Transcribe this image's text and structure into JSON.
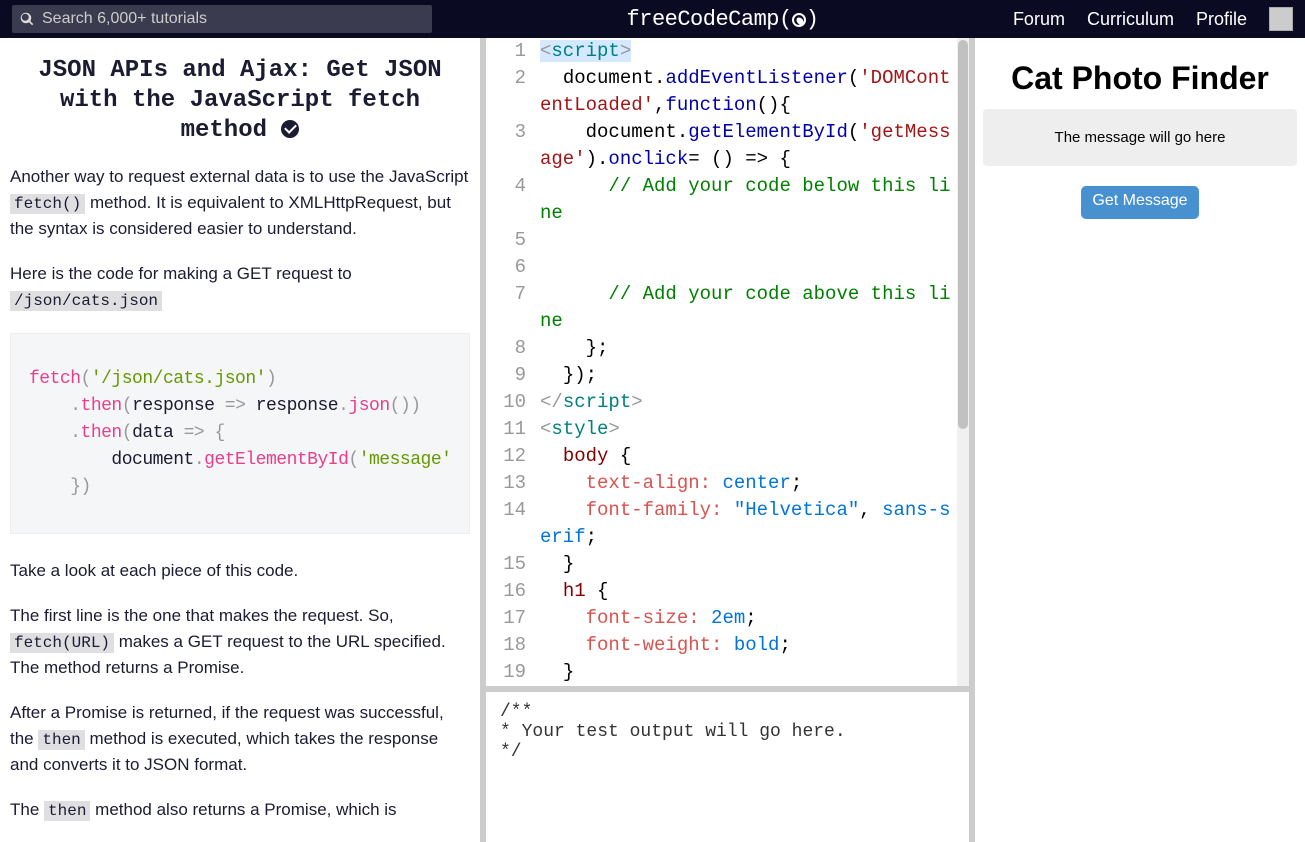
{
  "header": {
    "search_placeholder": "Search 6,000+ tutorials",
    "brand": "freeCodeCamp",
    "nav": {
      "forum": "Forum",
      "curriculum": "Curriculum",
      "profile": "Profile"
    }
  },
  "lesson": {
    "title": "JSON APIs and Ajax: Get JSON with the JavaScript fetch method",
    "p1a": "Another way to request external data is to use the JavaScript ",
    "p1_code": "fetch()",
    "p1b": " method. It is equivalent to XMLHttpRequest, but the syntax is considered easier to understand.",
    "p2a": "Here is the code for making a GET request to ",
    "p2_code": "/json/cats.json",
    "code": {
      "l1": {
        "fetch": "fetch",
        "lp": "(",
        "str": "'/json/cats.json'",
        "rp": ")"
      },
      "l2": {
        "dot": ".",
        "then": "then",
        "lp": "(",
        "arg": "response ",
        "arrow": "=>",
        "sp": " response",
        "d2": ".",
        "json": "json",
        "call": "()",
        "rp": ")"
      },
      "l3": {
        "dot": ".",
        "then": "then",
        "lp": "(",
        "arg": "data ",
        "arrow": "=>",
        "sp": " ",
        "brace": "{"
      },
      "l4": {
        "doc": "document",
        "dot": ".",
        "gbi": "getElementById",
        "lp": "(",
        "str": "'message'"
      },
      "l5": {
        "close": "})"
      }
    },
    "p3": "Take a look at each piece of this code.",
    "p4a": "The first line is the one that makes the request. So, ",
    "p4_code": "fetch(URL)",
    "p4b": " makes a GET request to the URL specified. The method returns a Promise.",
    "p5a": "After a Promise is returned, if the request was successful, the ",
    "p5_code": "then",
    "p5b": " method is executed, which takes the response and converts it to JSON format.",
    "p6a": "The ",
    "p6_code": "then",
    "p6b": " method also returns a Promise, which is"
  },
  "editor": {
    "lines": [
      {
        "n": "1",
        "html": "<span class='tok-angle hl'>&lt;</span><span class='tok-tag hl'>script</span><span class='tok-angle hl'>&gt;</span>"
      },
      {
        "n": "2",
        "html": "  <span class='tok-js'>document</span>.<span class='tok-fn'>addEventListener</span>(<span class='tok-str'>'DOMContentLoaded'</span>,<span class='tok-fn'>function</span>(){"
      },
      {
        "n": "3",
        "html": "    <span class='tok-js'>document</span>.<span class='tok-fn'>getElementById</span>(<span class='tok-str'>'getMessage'</span>).<span class='tok-fn'>onclick</span>= () =&gt; {"
      },
      {
        "n": "4",
        "html": "      <span class='tok-comment'>// Add your code below this line</span>"
      },
      {
        "n": "5",
        "html": ""
      },
      {
        "n": "6",
        "html": ""
      },
      {
        "n": "7",
        "html": "      <span class='tok-comment'>// Add your code above this line</span>"
      },
      {
        "n": "8",
        "html": "    };"
      },
      {
        "n": "9",
        "html": "  });"
      },
      {
        "n": "10",
        "html": "<span class='tok-angle'>&lt;/</span><span class='tok-tag'>script</span><span class='tok-angle'>&gt;</span>"
      },
      {
        "n": "11",
        "html": "<span class='tok-angle'>&lt;</span><span class='tok-tag'>style</span><span class='tok-angle'>&gt;</span>"
      },
      {
        "n": "12",
        "html": "  <span class='tok-sel'>body</span> {"
      },
      {
        "n": "13",
        "html": "    <span class='tok-prop'>text-align:</span> <span class='tok-val'>center</span>;"
      },
      {
        "n": "14",
        "html": "    <span class='tok-prop'>font-family:</span> <span class='tok-val'>\"Helvetica\"</span>, <span class='tok-val'>sans-serif</span>;"
      },
      {
        "n": "15",
        "html": "  }"
      },
      {
        "n": "16",
        "html": "  <span class='tok-sel'>h1</span> {"
      },
      {
        "n": "17",
        "html": "    <span class='tok-prop'>font-size:</span> <span class='tok-val'>2em</span>;"
      },
      {
        "n": "18",
        "html": "    <span class='tok-prop'>font-weight:</span> <span class='tok-val'>bold</span>;"
      },
      {
        "n": "19",
        "html": "  }"
      }
    ]
  },
  "console": "/**\n* Your test output will go here.\n*/",
  "preview": {
    "title": "Cat Photo Finder",
    "message": "The message will go here",
    "button": "Get Message"
  }
}
